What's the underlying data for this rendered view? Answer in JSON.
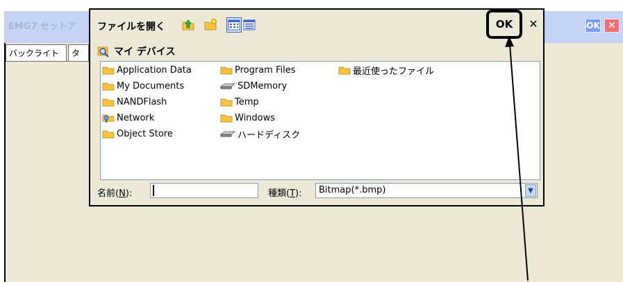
{
  "background_window": {
    "title": "EMG7 セットア",
    "ok_label": "OK",
    "close_label": "✕",
    "tabs": [
      "バックライト",
      "タ"
    ]
  },
  "dialog": {
    "title": "ファイルを開く",
    "ok_label": "OK",
    "close_label": "✕",
    "location": "マイ デバイス",
    "toolbar_icons": [
      "up-folder-icon",
      "new-folder-icon",
      "list-view-icon",
      "details-view-icon"
    ],
    "files": [
      {
        "name": "Application Data",
        "icon": "folder-icon"
      },
      {
        "name": "My Documents",
        "icon": "folder-icon"
      },
      {
        "name": "NANDFlash",
        "icon": "folder-icon"
      },
      {
        "name": "Network",
        "icon": "network-icon"
      },
      {
        "name": "Object Store",
        "icon": "folder-icon"
      },
      {
        "name": "Program Files",
        "icon": "folder-icon"
      },
      {
        "name": "SDMemory",
        "icon": "storage-card-icon"
      },
      {
        "name": "Temp",
        "icon": "folder-icon"
      },
      {
        "name": "Windows",
        "icon": "folder-icon"
      },
      {
        "name": "ハードディスク",
        "icon": "storage-card-icon"
      },
      {
        "name": "最近使ったファイル",
        "icon": "folder-icon"
      }
    ],
    "name_label_pre": "名前(",
    "name_label_key": "N",
    "name_label_post": "):",
    "name_value": "",
    "type_label_pre": "種類(",
    "type_label_key": "T",
    "type_label_post": "):",
    "type_value": "Bitmap(*.bmp)"
  },
  "colors": {
    "folder": "#f6c343",
    "folder_dark": "#c9961c",
    "bg_titlebar": "#c6d3f7",
    "dialog_bg": "#ece9d8",
    "list_border": "#7f9db9"
  }
}
